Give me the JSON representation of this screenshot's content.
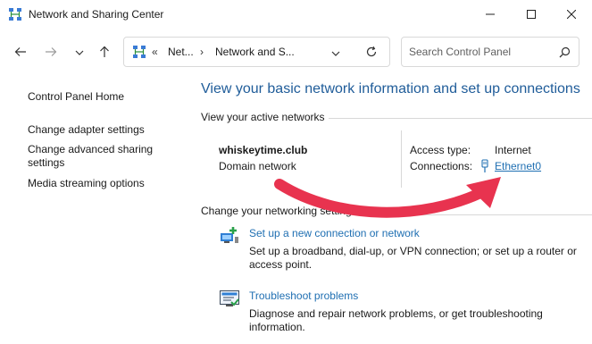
{
  "window": {
    "title": "Network and Sharing Center",
    "app_icon": "network-icon",
    "minimize_icon": "minimize-icon",
    "maximize_icon": "maximize-icon",
    "close_icon": "close-icon"
  },
  "nav": {
    "back_icon": "arrow-left-icon",
    "forward_icon": "arrow-right-icon",
    "recent_icon": "chevron-down-icon",
    "up_icon": "arrow-up-icon"
  },
  "address": {
    "overflow": "«",
    "segments": [
      "Net...",
      "Network and S..."
    ],
    "separator": "›"
  },
  "search": {
    "placeholder": "Search Control Panel"
  },
  "sidebar": {
    "items": [
      {
        "label": "Control Panel Home"
      },
      {
        "label": "Change adapter settings"
      },
      {
        "label": "Change advanced sharing settings"
      },
      {
        "label": "Media streaming options"
      }
    ]
  },
  "main": {
    "heading": "View your basic network information and set up connections",
    "active_networks_label": "View your active networks",
    "network": {
      "name": "whiskeytime.club",
      "type": "Domain network",
      "access_type_label": "Access type:",
      "access_type_value": "Internet",
      "connections_label": "Connections:",
      "connection_name": "Ethernet0"
    },
    "change_settings_label": "Change your networking settings",
    "tasks": [
      {
        "title": "Set up a new connection or network",
        "desc": "Set up a broadband, dial-up, or VPN connection; or set up a router or access point."
      },
      {
        "title": "Troubleshoot problems",
        "desc": "Diagnose and repair network problems, or get troubleshooting information."
      }
    ]
  },
  "annotation": {
    "arrow_color": "#e8334f"
  }
}
